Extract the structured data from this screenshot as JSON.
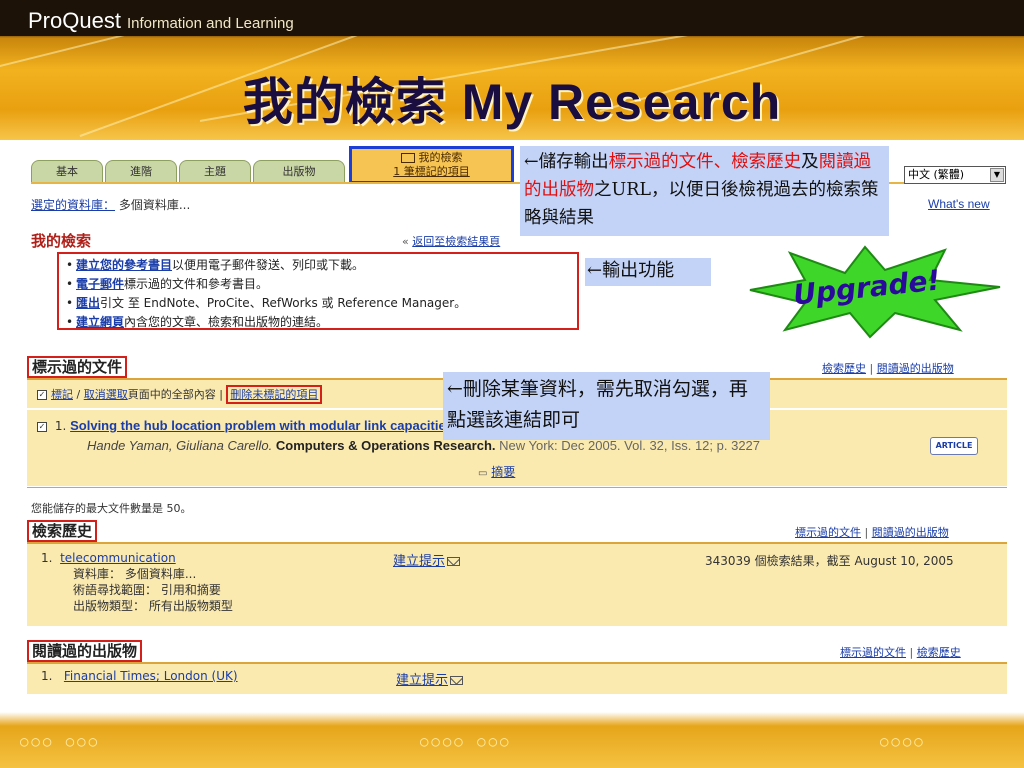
{
  "header": {
    "brand": "ProQuest",
    "brand_sub": "Information and Learning",
    "title": "我的檢索 My Research"
  },
  "tabs": [
    "基本",
    "進階",
    "主題",
    "出版物"
  ],
  "active_tab": {
    "line1": "我的檢索",
    "line2": "1 筆標記的項目"
  },
  "language": "中文 (繁體)",
  "databases": {
    "label": "選定的資料庫：",
    "value": "多個資料庫..."
  },
  "whats_new": "What's new",
  "my_search": {
    "heading": "我的檢索",
    "back_link": "返回至檢索結果頁",
    "back_prefix": "«",
    "items": [
      {
        "link": "建立您的參考書目",
        "text": "以便用電子郵件發送、列印或下載。"
      },
      {
        "link": "電子郵件",
        "text": "標示過的文件和參考書目。"
      },
      {
        "link": "匯出",
        "text": "引文 至 EndNote、ProCite、RefWorks 或 Reference Manager。"
      },
      {
        "link": "建立網頁",
        "text": "內含您的文章、檢索和出版物的連結。"
      }
    ]
  },
  "marked": {
    "heading": "標示過的文件",
    "links": [
      "檢索歷史",
      "閱讀過的出版物"
    ],
    "toolbar": {
      "mark": "標記",
      "unmark": "取消選取",
      "text": "頁面中的全部內容",
      "delete": "刪除未標記的項目"
    },
    "article": {
      "number": "1.",
      "title": "Solving the hub location problem with modular link capacities",
      "authors": "Hande Yaman, Giuliana Carello.",
      "journal": "Computers & Operations Research.",
      "details": "New York: Dec 2005. Vol. 32, Iss. 12; p. 3227",
      "format": "ARTICLE",
      "abstract": "摘要"
    },
    "max_docs": "您能儲存的最大文件數量是 50。"
  },
  "history": {
    "heading": "檢索歷史",
    "links": [
      "標示過的文件",
      "閱讀過的出版物"
    ],
    "row": {
      "number": "1.",
      "query": "telecommunication",
      "db": "資料庫： 多個資料庫...",
      "scope": "術語尋找範圍： 引用和摘要",
      "pubtype": "出版物類型： 所有出版物類型",
      "alert": "建立提示",
      "results": "343039 個檢索結果，截至 August 10, 2005"
    }
  },
  "publications": {
    "heading": "閱讀過的出版物",
    "links": [
      "標示過的文件",
      "檢索歷史"
    ],
    "row": {
      "number": "1.",
      "name": "Financial Times; London (UK)",
      "alert": "建立提示"
    }
  },
  "callouts": {
    "c1_parts": [
      "←儲存輸出",
      "標示過的文件",
      "、",
      "檢索歷史",
      "及",
      "閱讀過的出版物",
      "之URL，以便日後檢視過去的檢索策略與結果"
    ],
    "c2": "←輸出功能",
    "c3": "←刪除某筆資料，需先取消勾選，再點選該連結即可"
  },
  "upgrade": "Upgrade!",
  "colors": {
    "accent_red": "#d4201a",
    "link_blue": "#1a3da8",
    "callout_bg": "#c3d3f7",
    "band": "#fbeab0",
    "burst": "#3fd62a"
  }
}
